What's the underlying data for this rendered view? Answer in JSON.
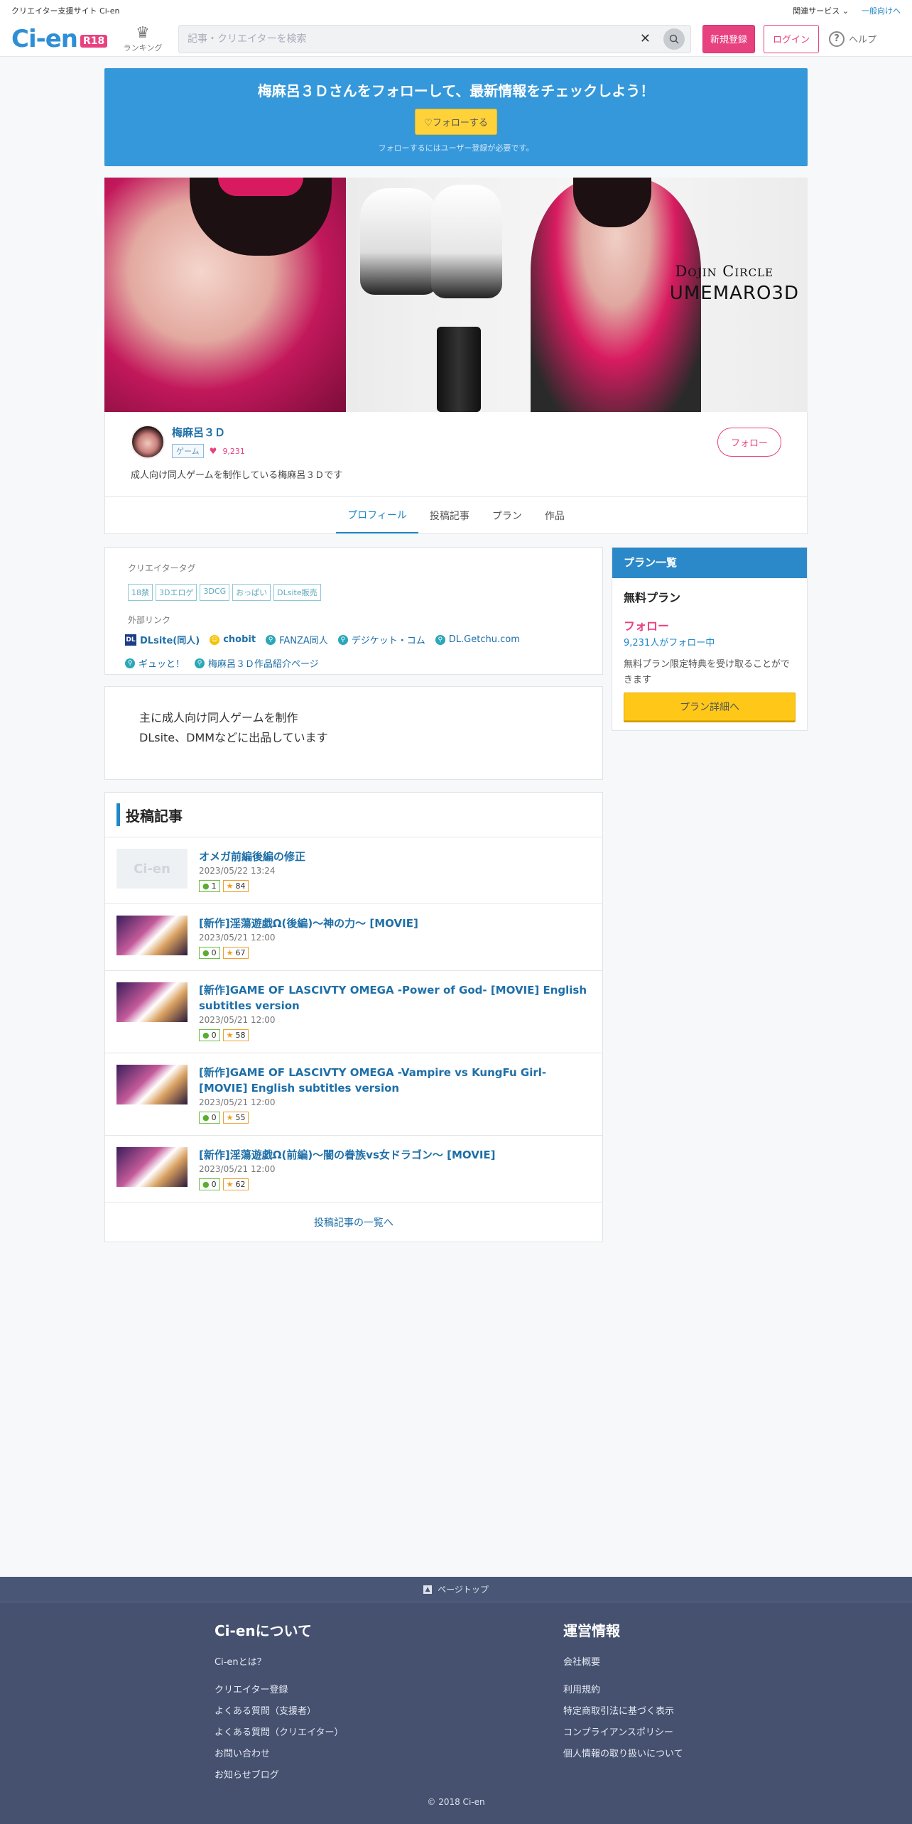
{
  "topbar": {
    "site_caption": "クリエイター支援サイト Ci-en",
    "related_services": "関連サービス",
    "general_link": "一般向けへ"
  },
  "header": {
    "logo_text": "Ci-en",
    "logo_badge": "R18",
    "ranking_label": "ランキング",
    "search_placeholder": "記事・クリエイターを検索",
    "register_label": "新規登録",
    "login_label": "ログイン",
    "help_label": "ヘルプ"
  },
  "follow_banner": {
    "headline": "梅麻呂３Ｄさんをフォローして、最新情報をチェックしよう！",
    "button_label": "♡フォローする",
    "note": "フォローするにはユーザー登録が必要です。"
  },
  "hero": {
    "circle_line1": "Dojin Circle",
    "circle_line2": "UMEMARO3D"
  },
  "creator": {
    "name": "梅麻呂３Ｄ",
    "genre": "ゲーム",
    "followers": "9,231",
    "description": "成人向け同人ゲームを制作している梅麻呂３Ｄです",
    "follow_label": "フォロー"
  },
  "tabs": [
    {
      "label": "プロフィール",
      "active": true
    },
    {
      "label": "投稿記事"
    },
    {
      "label": "プラン"
    },
    {
      "label": "作品"
    }
  ],
  "profile": {
    "tags_label": "クリエイタータグ",
    "tags": [
      "18禁",
      "3Dエロゲ",
      "3DCG",
      "おっぱい",
      "DLsite販売"
    ],
    "links_label": "外部リンク",
    "links": [
      {
        "label": "DLsite(同人)",
        "icon": "dlsite-icon"
      },
      {
        "label": "chobit",
        "icon": "chobit-icon"
      },
      {
        "label": "FANZA同人",
        "icon": "link-icon"
      },
      {
        "label": "デジケット・コム",
        "icon": "link-icon"
      },
      {
        "label": "DL.Getchu.com",
        "icon": "link-icon"
      },
      {
        "label": "ギュッと！",
        "icon": "link-icon"
      },
      {
        "label": "梅麻呂３Ｄ作品紹介ページ",
        "icon": "link-icon"
      }
    ],
    "intro_line1": "主に成人向け同人ゲームを制作",
    "intro_line2": "DLsite、DMMなどに出品しています"
  },
  "posts": {
    "heading": "投稿記事",
    "items": [
      {
        "title": "オメガ前編後編の修正",
        "date": "2023/05/22 13:24",
        "comments": "1",
        "likes": "84",
        "thumb": "placeholder"
      },
      {
        "title": "[新作]淫蕩遊戯Ω(後編)～神の力～ [MOVIE]",
        "date": "2023/05/21 12:00",
        "comments": "0",
        "likes": "67",
        "thumb": "image"
      },
      {
        "title": "[新作]GAME OF LASCIVTY OMEGA -Power of God- [MOVIE] English subtitles version",
        "date": "2023/05/21 12:00",
        "comments": "0",
        "likes": "58",
        "thumb": "image"
      },
      {
        "title": "[新作]GAME OF LASCIVTY OMEGA -Vampire vs KungFu Girl- [MOVIE] English subtitles version",
        "date": "2023/05/21 12:00",
        "comments": "0",
        "likes": "55",
        "thumb": "image"
      },
      {
        "title": "[新作]淫蕩遊戯Ω(前編)～闇の眷族vs女ドラゴン～ [MOVIE]",
        "date": "2023/05/21 12:00",
        "comments": "0",
        "likes": "62",
        "thumb": "image"
      }
    ],
    "placeholder_text": "Ci-en",
    "more_label": "投稿記事の一覧へ"
  },
  "plans": {
    "heading": "プラン一覧",
    "plan_name": "無料プラン",
    "follow_label": "フォロー",
    "follow_count": "9,231人がフォロー中",
    "description": "無料プラン限定特典を受け取ることができます",
    "detail_button": "プラン詳細へ"
  },
  "footer": {
    "page_top": "ページトップ",
    "about_heading": "Ci-enについて",
    "about_links": [
      "Ci-enとは？",
      "クリエイター登録",
      "よくある質問（支援者）",
      "よくある質問（クリエイター）",
      "お問い合わせ",
      "お知らせブログ"
    ],
    "ops_heading": "運営情報",
    "ops_links": [
      "会社概要",
      "利用規約",
      "特定商取引法に基づく表示",
      "コンプライアンスポリシー",
      "個人情報の取り扱いについて"
    ],
    "copyright": "© 2018 Ci-en"
  },
  "colors": {
    "brand_blue": "#2f8fd6",
    "brand_pink": "#e8417f",
    "banner_blue": "#3598db",
    "footer_bg": "#45516f",
    "plan_button": "#ffc819"
  }
}
